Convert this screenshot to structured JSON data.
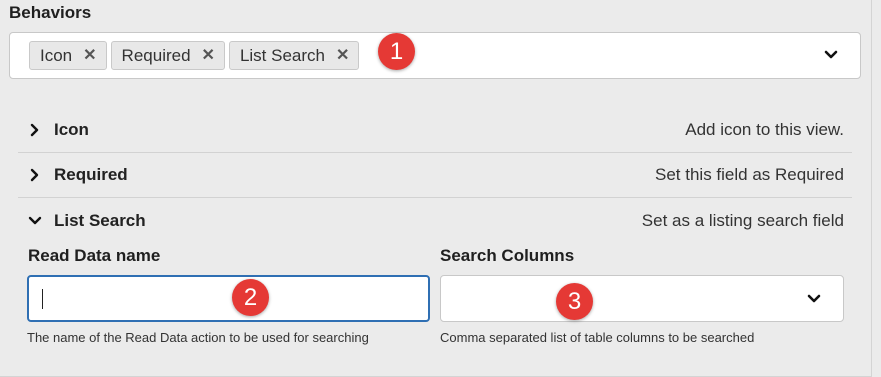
{
  "behaviors": {
    "title": "Behaviors",
    "tags": [
      {
        "label": "Icon"
      },
      {
        "label": "Required"
      },
      {
        "label": "List Search"
      }
    ],
    "remove_glyph": "✕",
    "toggle_icon": "chevron-down-icon"
  },
  "badges": [
    "1",
    "2",
    "3"
  ],
  "accordion": [
    {
      "name": "Icon",
      "description": "Add icon to this view.",
      "expanded": false
    },
    {
      "name": "Required",
      "description": "Set this field as Required",
      "expanded": false
    },
    {
      "name": "List Search",
      "description": "Set as a listing search field",
      "expanded": true
    }
  ],
  "list_search": {
    "read_data_label": "Read Data name",
    "read_data_value": "",
    "read_data_help": "The name of the Read Data action to be used for searching",
    "search_columns_label": "Search Columns",
    "search_columns_value": "",
    "search_columns_help": "Comma separated list of table columns to be searched"
  },
  "colors": {
    "badge": "#e53935",
    "focus_border": "#2f6fb3",
    "background": "#ebebeb"
  }
}
